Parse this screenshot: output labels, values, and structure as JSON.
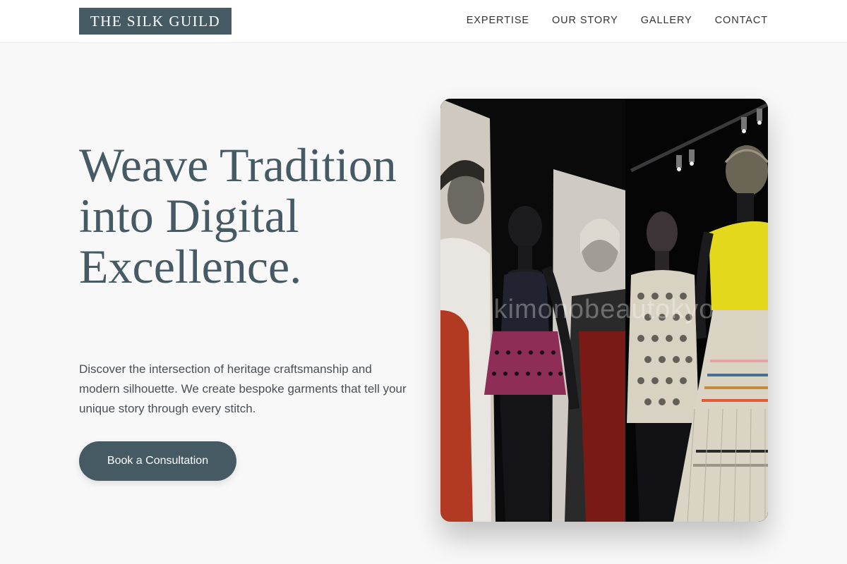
{
  "brand": {
    "name": "THE SILK GUILD"
  },
  "nav": {
    "items": [
      {
        "label": "EXPERTISE"
      },
      {
        "label": "OUR STORY"
      },
      {
        "label": "GALLERY"
      },
      {
        "label": "CONTACT"
      }
    ]
  },
  "hero": {
    "title": "Weave Tradition into Digital Excellence.",
    "description": "Discover the intersection of heritage craftsmanship and modern silhouette. We create bespoke garments that tell your unique story through every stitch.",
    "cta_label": "Book a Consultation",
    "image_watermark": "kimonobeautokyo"
  },
  "colors": {
    "primary": "#465a64",
    "background": "#f8f8f8",
    "header_bg": "#ffffff",
    "body_text": "#4a4f55"
  }
}
